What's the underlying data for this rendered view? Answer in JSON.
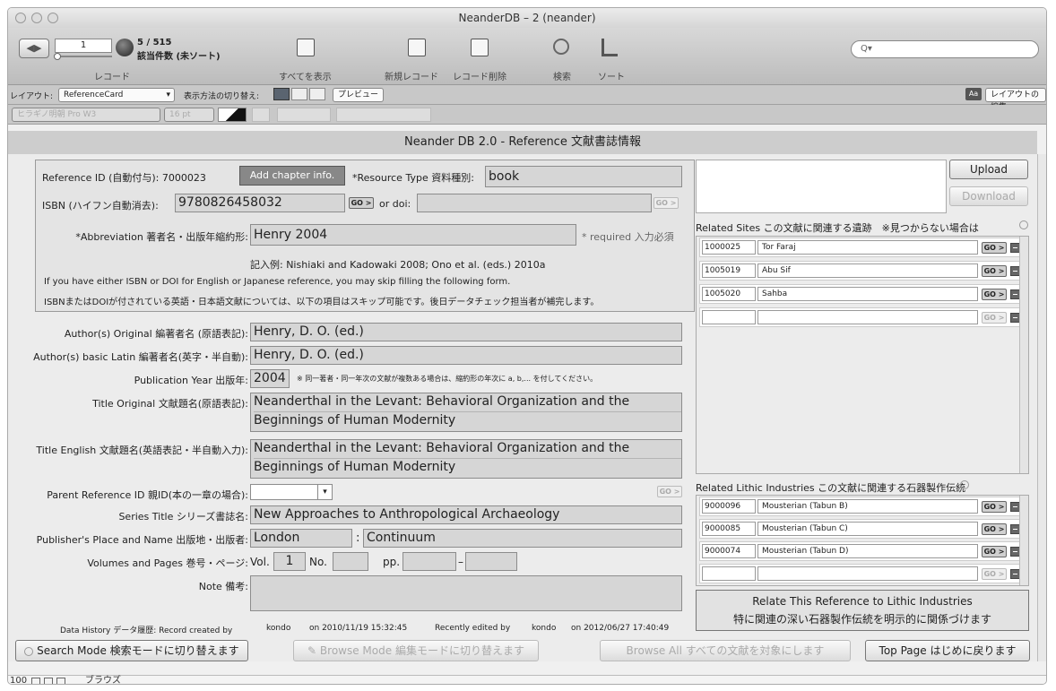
{
  "window": {
    "title": "NeanderDB – 2 (neander)"
  },
  "toolbar": {
    "record_number": "1",
    "record_count": "5 / 515",
    "record_status": "該当件数 (未ソート)",
    "record_label": "レコード",
    "show_all": "すべてを表示",
    "new_record": "新規レコード",
    "delete_record": "レコード削除",
    "search": "検索",
    "sort": "ソート",
    "search_placeholder": "Q▾"
  },
  "layoutbar": {
    "layout_label": "レイアウト:",
    "layout_value": "ReferenceCard",
    "view_label": "表示方法の切り替え:",
    "preview": "プレビュー",
    "font_size_icon": "Aa",
    "edit_layout": "レイアウトの編集"
  },
  "formatbar": {
    "font": "ヒラギノ明朝 Pro W3",
    "size": "16 pt"
  },
  "header": {
    "title": "Neander DB 2.0 - Reference 文献書誌情報"
  },
  "ref": {
    "id_label": "Reference ID (自動付与): 7000023",
    "add_chapter": "Add chapter info.",
    "type_label": "*Resource Type 資料種別:",
    "type_value": "book",
    "isbn_label": "ISBN (ハイフン自動消去):",
    "isbn_value": "9780826458032",
    "go": "GO >",
    "doi_label": "or doi:",
    "abbr_label": "*Abbreviation 著者名・出版年縮約形:",
    "abbr_value": "Henry 2004",
    "required": "* required 入力必須",
    "example": "記入例: Nishiaki and Kadowaki 2008; Ono et al. (eds.) 2010a",
    "note1": "If you have either ISBN or DOI for English or Japanese reference, you may skip filling the following form.",
    "note2": "ISBNまたはDOIが付されている英語・日本語文献については、以下の項目はスキップ可能です。後日データチェック担当者が補完します。"
  },
  "form": {
    "author_orig_label": "Author(s) Original 編著者名 (原語表記):",
    "author_orig": "Henry, D. O. (ed.)",
    "author_latin_label": "Author(s) basic Latin 編著者名(英字・半自動):",
    "author_latin": "Henry, D. O. (ed.)",
    "year_label": "Publication Year 出版年:",
    "year": "2004",
    "year_note": "※ 同一著者・同一年次の文献が複数ある場合は、縮約形の年次に a, b,... を付してください。",
    "title_orig_label": "Title Original 文献題名(原語表記):",
    "title_orig_1": "Neanderthal in the Levant: Behavioral Organization and the",
    "title_orig_2": "Beginnings of Human Modernity",
    "title_en_label": "Title English 文献題名(英語表記・半自動入力):",
    "title_en_1": "Neanderthal in the Levant: Behavioral Organization and the",
    "title_en_2": "Beginnings of Human Modernity",
    "parent_label": "Parent Reference ID 親ID(本の一章の場合):",
    "series_label": "Series Title シリーズ書誌名:",
    "series": "New Approaches to Anthropological Archaeology",
    "publisher_label": "Publisher's Place and Name 出版地・出版者:",
    "place": "London",
    "publisher": "Continuum",
    "vol_label": "Volumes and Pages 巻号・ページ:",
    "vol_prefix": "Vol.",
    "vol": "1",
    "no_prefix": "No.",
    "pp_prefix": "pp.",
    "dash": "–",
    "colon": ":",
    "note_label": "Note 備考:"
  },
  "history": {
    "label": "Data History データ履歴: Record created by",
    "created_by": "kondo",
    "created_on": "on 2010/11/19 15:32:45",
    "edited_label": "Recently edited by",
    "edited_by": "kondo",
    "edited_on": "on 2012/06/27 17:40:49"
  },
  "buttons": {
    "search_mode": "Search Mode 検索モードに切り替えます",
    "browse_mode": "Browse Mode 編集モードに切り替えます",
    "browse_all": "Browse All すべての文献を対象にします",
    "top_page": "Top Page はじめに戻ります"
  },
  "side": {
    "upload": "Upload",
    "download": "Download",
    "sites_label": "Related Sites この文献に関連する遺跡　※見つからない場合は",
    "sites": [
      {
        "id": "1000025",
        "name": "Tor Faraj"
      },
      {
        "id": "1005019",
        "name": "Abu Sif"
      },
      {
        "id": "1005020",
        "name": "Sahba"
      }
    ],
    "lithic_label": "Related Lithic Industries この文献に関連する石器製作伝統",
    "lithics": [
      {
        "id": "9000096",
        "name": "Mousterian (Tabun B)"
      },
      {
        "id": "9000085",
        "name": "Mousterian (Tabun C)"
      },
      {
        "id": "9000074",
        "name": "Mousterian (Tabun D)"
      }
    ],
    "relate_1": "Relate This Reference to Lithic Industries",
    "relate_2": "特に関連の深い石器製作伝統を明示的に関係づけます"
  },
  "status": {
    "zoom": "100",
    "mode": "ブラウズ"
  }
}
